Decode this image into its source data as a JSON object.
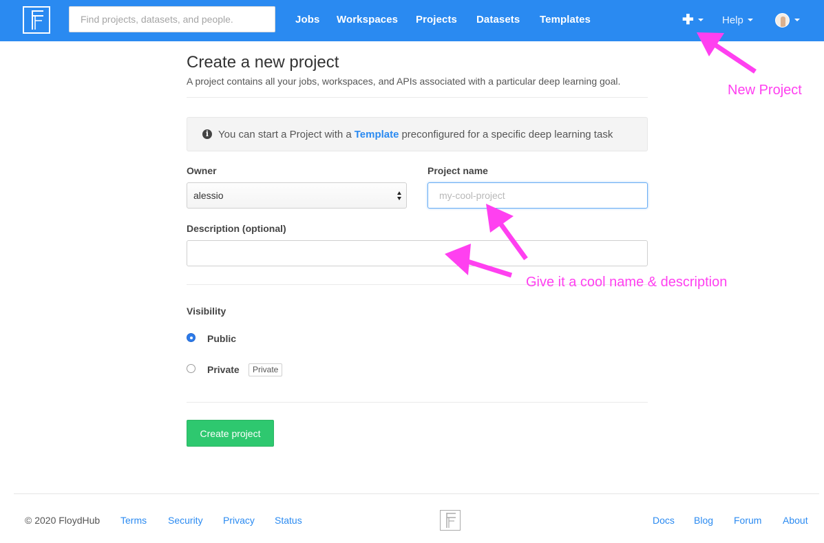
{
  "navbar": {
    "search_placeholder": "Find projects, datasets, and people.",
    "links": [
      "Jobs",
      "Workspaces",
      "Projects",
      "Datasets",
      "Templates"
    ],
    "help_label": "Help"
  },
  "page": {
    "title": "Create a new project",
    "subtitle": "A project contains all your jobs, workspaces, and APIs associated with a particular deep learning goal."
  },
  "info": {
    "prefix": "You can start a Project with a",
    "link": "Template",
    "suffix": "preconfigured for a specific deep learning task"
  },
  "form": {
    "owner_label": "Owner",
    "owner_value": "alessio",
    "project_name_label": "Project name",
    "project_name_placeholder": "my-cool-project",
    "description_label": "Description (optional)",
    "visibility_label": "Visibility",
    "public_label": "Public",
    "private_label": "Private",
    "private_badge": "Private",
    "selected_visibility": "Public",
    "submit_label": "Create project"
  },
  "footer": {
    "copyright": "© 2020 FloydHub",
    "left_links": [
      "Terms",
      "Security",
      "Privacy",
      "Status"
    ],
    "right_links": [
      "Docs",
      "Blog",
      "Forum",
      "About"
    ]
  },
  "annotations": {
    "new_project": "New Project",
    "name_description": "Give it a cool name & description",
    "color": "#ff40f0"
  },
  "colors": {
    "navbar": "#2a8af1",
    "primary_link": "#2a8af1",
    "create_button": "#2ec86f"
  }
}
